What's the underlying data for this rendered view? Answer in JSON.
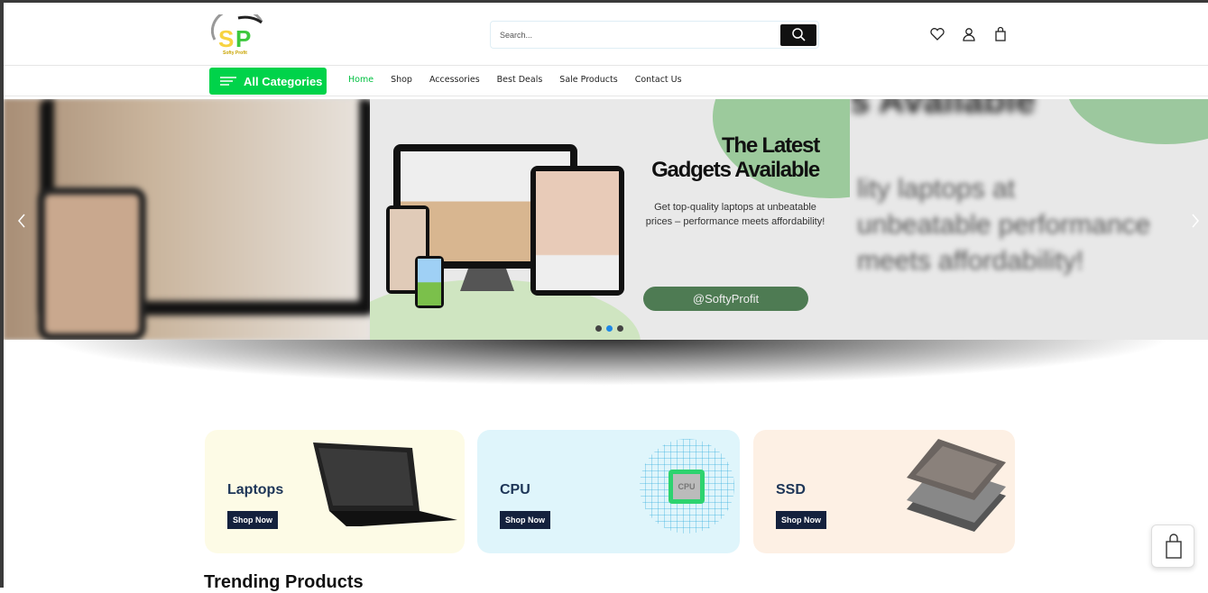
{
  "brand": {
    "logo_letters": "SP",
    "logo_tagline": "Softy Profit"
  },
  "search": {
    "placeholder": "Search..."
  },
  "header_icons": [
    "heart-icon",
    "user-icon",
    "cart-icon"
  ],
  "nav": {
    "all_categories": "All Categories",
    "links": [
      "Home",
      "Shop",
      "Accessories",
      "Best Deals",
      "Sale Products",
      "Contact Us"
    ],
    "active": "Home"
  },
  "banner": {
    "heading_line1": "The Latest",
    "heading_line2": "Gadgets Available",
    "text": "Get top-quality laptops at unbeatable prices – performance meets affordability!",
    "handle": "@SoftyProfit",
    "right_blur_text": "lity laptops at unbeatable performance meets affordability!",
    "right_blur_heading": "s Available",
    "slides": 3,
    "active_slide": 2
  },
  "categories": [
    {
      "title": "Laptops",
      "button": "Shop Now",
      "bg": "#fdfbe6"
    },
    {
      "title": "CPU",
      "button": "Shop Now",
      "bg": "#dff5fb",
      "chip_label": "CPU"
    },
    {
      "title": "SSD",
      "button": "Shop Now",
      "bg": "#fdf0e4"
    }
  ],
  "section": {
    "trending": "Trending Products"
  },
  "colors": {
    "accent": "#00d34a",
    "button_dark": "#14213d",
    "handle_green": "#4e7b53"
  }
}
